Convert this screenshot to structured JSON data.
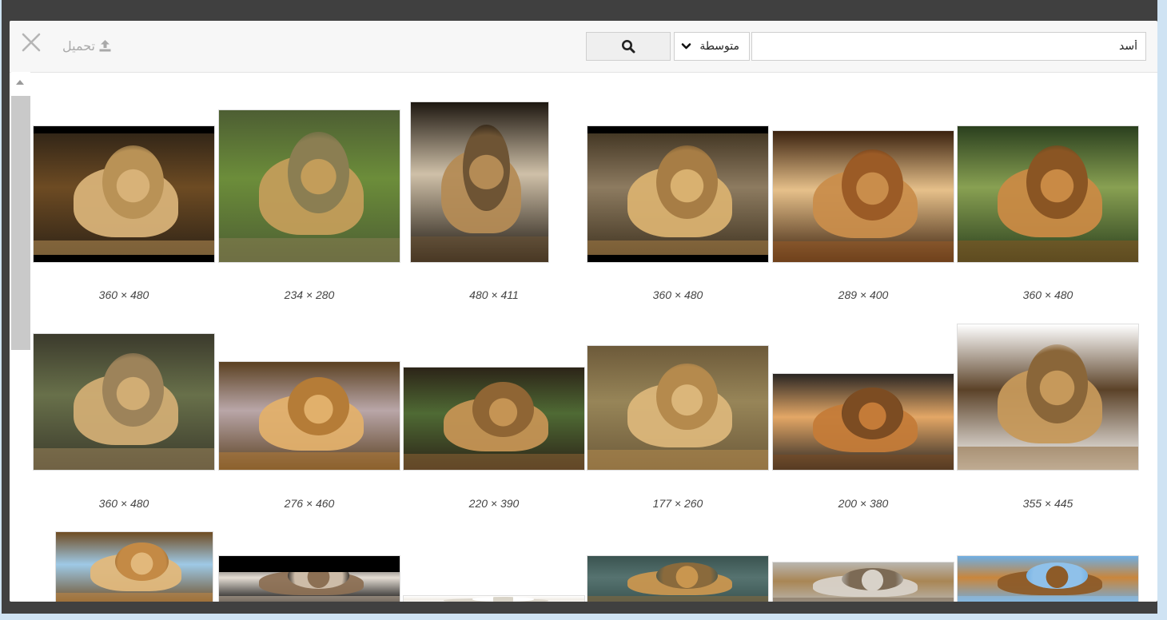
{
  "topbar": {
    "close_icon": "close-icon",
    "upload_label": "تحميل",
    "upload_icon": "upload-icon",
    "search_icon": "search-icon",
    "size_select_value": "متوسطة",
    "size_select_icon": "chevron-down-icon",
    "search_value": "أسد"
  },
  "colors": {
    "background": "#404040",
    "dialog": "#ffffff",
    "topbar": "#f7f7f7",
    "scroll_thumb": "#c9c9c9",
    "screen_edge": "#cfe3f3"
  },
  "results": [
    {
      "caption": "360 × 480",
      "palette": [
        "#2b2116",
        "#b99256",
        "#d8b278",
        "#6d4b23"
      ]
    },
    {
      "caption": "234 × 280",
      "palette": [
        "#4d5e33",
        "#8b7e52",
        "#c39d5a",
        "#6c8d3a"
      ]
    },
    {
      "caption": "480 × 411",
      "palette": [
        "#1d1710",
        "#6e5434",
        "#b48b55",
        "#cfc0a8"
      ]
    },
    {
      "caption": "360 × 480",
      "palette": [
        "#3b2f1d",
        "#a77d45",
        "#d9b170",
        "#8d7b60"
      ]
    },
    {
      "caption": "289 × 400",
      "palette": [
        "#3b220f",
        "#9b5b26",
        "#c98d4b",
        "#e6c08a"
      ]
    },
    {
      "caption": "360 × 480",
      "palette": [
        "#2a3f1e",
        "#8a5523",
        "#c98a45",
        "#88a052"
      ]
    },
    {
      "caption": "360 × 480",
      "palette": [
        "#3b3a2c",
        "#9d835a",
        "#d1ad74",
        "#68704a"
      ]
    },
    {
      "caption": "276 × 460",
      "palette": [
        "#5b4122",
        "#b57c37",
        "#e1b06b",
        "#b9a6a8"
      ]
    },
    {
      "caption": "220 × 390",
      "palette": [
        "#2c2418",
        "#8f6534",
        "#c59454",
        "#4f6a34"
      ]
    },
    {
      "caption": "177 × 260",
      "palette": [
        "#6d5a3a",
        "#b58a4d",
        "#dbb67a",
        "#978558"
      ]
    },
    {
      "caption": "200 × 380",
      "palette": [
        "#2a2623",
        "#7c4c22",
        "#c47b38",
        "#e3a766"
      ]
    },
    {
      "caption": "355 × 445",
      "palette": [
        "#ffffff",
        "#8a6639",
        "#c6995b",
        "#5b4228"
      ]
    },
    {
      "caption": "",
      "palette": [
        "#6f4c22",
        "#c48a45",
        "#e2b87b",
        "#9ec9e6"
      ]
    },
    {
      "caption": "",
      "palette": [
        "#000000",
        "#cdbca8",
        "#8c7054",
        "#e4ddd4"
      ]
    },
    {
      "caption": "",
      "palette": [
        "#ffffff",
        "#ffffff",
        "#d9d4c8",
        "#f0ece5"
      ]
    },
    {
      "caption": "",
      "palette": [
        "#3a5350",
        "#8a6a3c",
        "#c9964f",
        "#567370"
      ]
    },
    {
      "caption": "",
      "palette": [
        "#b9b6b0",
        "#7c6a55",
        "#d8d2c9",
        "#a98655"
      ]
    },
    {
      "caption": "",
      "palette": [
        "#6faee3",
        "#8fc1ea",
        "#8d5b28",
        "#c9863c"
      ]
    }
  ]
}
